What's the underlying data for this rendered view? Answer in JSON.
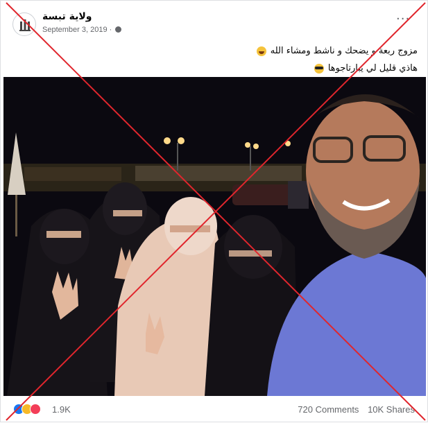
{
  "post": {
    "page_name": "ولاية تبسة",
    "date": "September 3, 2019",
    "separator": "·",
    "more_icon_glyph": "···",
    "caption_line1": "مزوج ربعة و يضحك و ناشط ومشاء الله",
    "caption_line2": "هاذي قليل لي يبارتاجوها"
  },
  "engagement": {
    "reaction_count": "1.9K",
    "comments": "720 Comments",
    "shares": "10K Shares",
    "reaction_icons": [
      "like-icon",
      "haha-icon",
      "love-icon"
    ]
  },
  "overlay": {
    "color": "#e0262d"
  },
  "colors": {
    "meta_text": "#65676b",
    "primary_text": "#050505",
    "like": "#1877f2",
    "haha": "#f7b928",
    "love": "#f33e58"
  }
}
